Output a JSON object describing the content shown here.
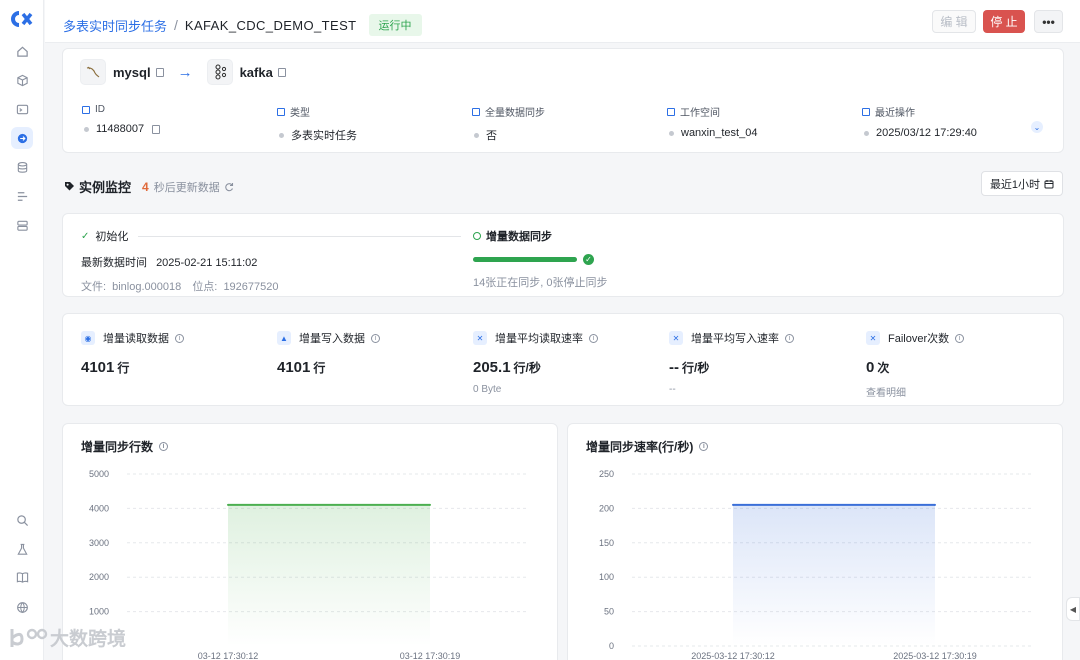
{
  "breadcrumb": {
    "parent": "多表实时同步任务",
    "separator": "/",
    "current": "KAFAK_CDC_DEMO_TEST",
    "status": "运行中"
  },
  "actions": {
    "edit": "编 辑",
    "stop": "停 止",
    "more": "•••"
  },
  "sidebar": {
    "nav_icons": [
      "home-icon",
      "cube-icon",
      "terminal-icon",
      "sync-icon",
      "database-icon",
      "list-icon",
      "storage-icon"
    ],
    "bottom_icons": [
      "search-icon",
      "flask-icon",
      "book-icon",
      "globe-icon"
    ]
  },
  "connection": {
    "source": "mysql",
    "target": "kafka"
  },
  "meta": [
    {
      "label": "ID",
      "value": "11488007"
    },
    {
      "label": "类型",
      "value": "多表实时任务"
    },
    {
      "label": "全量数据同步",
      "value": "否"
    },
    {
      "label": "工作空间",
      "value": "wanxin_test_04"
    },
    {
      "label": "最近操作",
      "value": "2025/03/12 17:29:40"
    }
  ],
  "monitor": {
    "title": "实例监控",
    "countdown": "4",
    "refresh_text": "秒后更新数据",
    "range_button": "最近1小时"
  },
  "stages": {
    "init": {
      "title": "初始化",
      "latest_label": "最新数据时间",
      "latest_time": "2025-02-21 15:11:02",
      "file_label": "文件:",
      "file": "binlog.000018",
      "pos_label": "位点:",
      "pos": "192677520"
    },
    "incr": {
      "title": "增量数据同步",
      "progress": 1.0,
      "summary": "14张正在同步, 0张停止同步"
    }
  },
  "metrics": [
    {
      "label": "增量读取数据",
      "value": "4101",
      "unit": "行",
      "sub": ""
    },
    {
      "label": "增量写入数据",
      "value": "4101",
      "unit": "行",
      "sub": ""
    },
    {
      "label": "增量平均读取速率",
      "value": "205.1",
      "unit": "行/秒",
      "sub": "0 Byte"
    },
    {
      "label": "增量平均写入速率",
      "value": "--",
      "unit": "行/秒",
      "sub": "--"
    },
    {
      "label": "Failover次数",
      "value": "0",
      "unit": "次",
      "sub": "查看明细"
    }
  ],
  "chart_data": [
    {
      "type": "area",
      "title": "增量同步行数",
      "x": [
        "03-12 17:30:12",
        "03-12 17:30:19"
      ],
      "y_ticks": [
        1000,
        2000,
        3000,
        4000,
        5000
      ],
      "ylim": [
        0,
        5000
      ],
      "series": [
        {
          "values": [
            4101,
            4101
          ]
        }
      ],
      "color": "#4caf50"
    },
    {
      "type": "area",
      "title": "增量同步速率(行/秒)",
      "x": [
        "2025-03-12 17:30:12",
        "2025-03-12 17:30:19"
      ],
      "y_ticks": [
        0,
        50,
        100,
        150,
        200,
        250
      ],
      "ylim": [
        0,
        250
      ],
      "series": [
        {
          "values": [
            205.1,
            205.1
          ]
        }
      ],
      "color": "#3b6fd8"
    }
  ],
  "watermark": "大数跨境"
}
